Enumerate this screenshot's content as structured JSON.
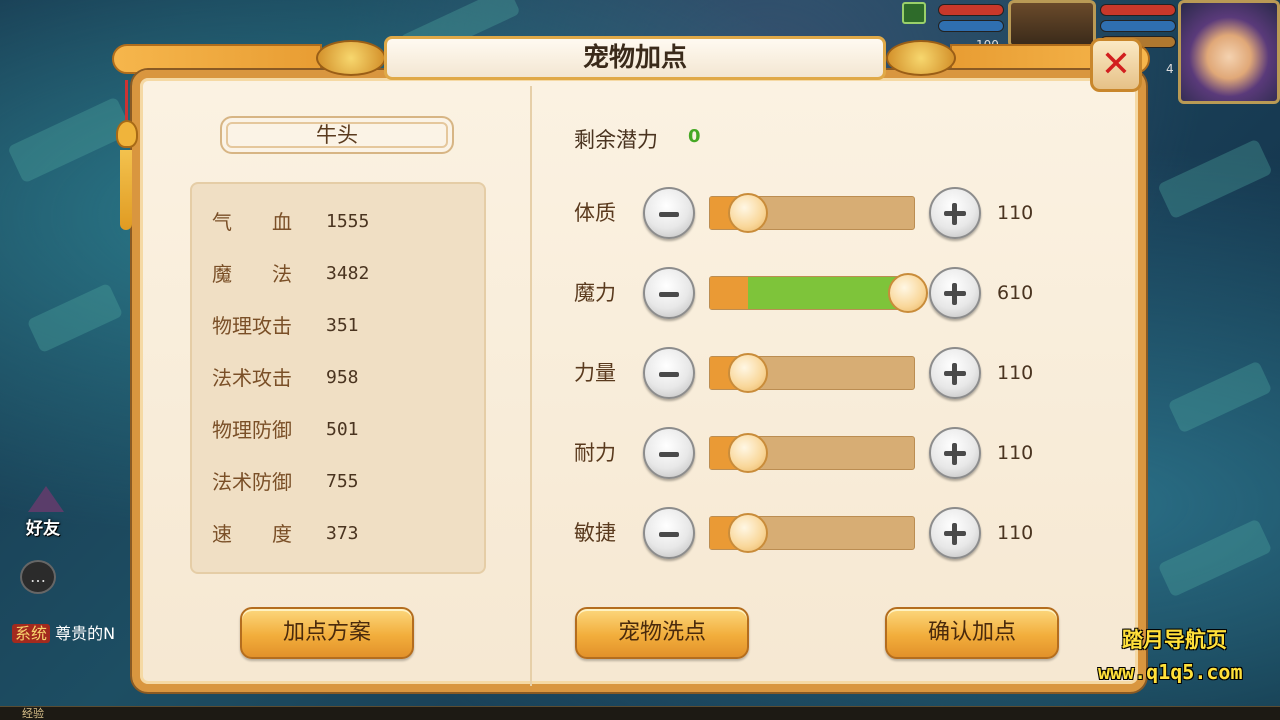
{
  "hud": {
    "num_left": "100",
    "num_right": "4",
    "colors": {
      "hp": "#c8382a",
      "mp": "#2f6fb0"
    }
  },
  "side": {
    "friend_label": "好友",
    "sys_tag": "系统",
    "sys_text": "尊贵的N",
    "exp_label": "经验"
  },
  "panel": {
    "title": "宠物加点",
    "close_icon": "close-x-icon"
  },
  "pet": {
    "name": "牛头",
    "stats": [
      {
        "label": "气　　血",
        "value": "1555"
      },
      {
        "label": "魔　　法",
        "value": "3482"
      },
      {
        "label": "物理攻击",
        "value": "351"
      },
      {
        "label": "法术攻击",
        "value": "958"
      },
      {
        "label": "物理防御",
        "value": "501"
      },
      {
        "label": "法术防御",
        "value": "755"
      },
      {
        "label": "速　　度",
        "value": "373"
      }
    ]
  },
  "allocation": {
    "potential_label": "剩余潜力",
    "potential_value": "0",
    "attributes": [
      {
        "label": "体质",
        "value": "110",
        "green_fraction": 0
      },
      {
        "label": "魔力",
        "value": "610",
        "green_fraction": 1
      },
      {
        "label": "力量",
        "value": "110",
        "green_fraction": 0
      },
      {
        "label": "耐力",
        "value": "110",
        "green_fraction": 0
      },
      {
        "label": "敏捷",
        "value": "110",
        "green_fraction": 0
      }
    ]
  },
  "buttons": {
    "scheme": "加点方案",
    "reset": "宠物洗点",
    "confirm": "确认加点"
  },
  "watermark": {
    "line1": "踏月导航页",
    "line2": "www.q1q5.com"
  }
}
